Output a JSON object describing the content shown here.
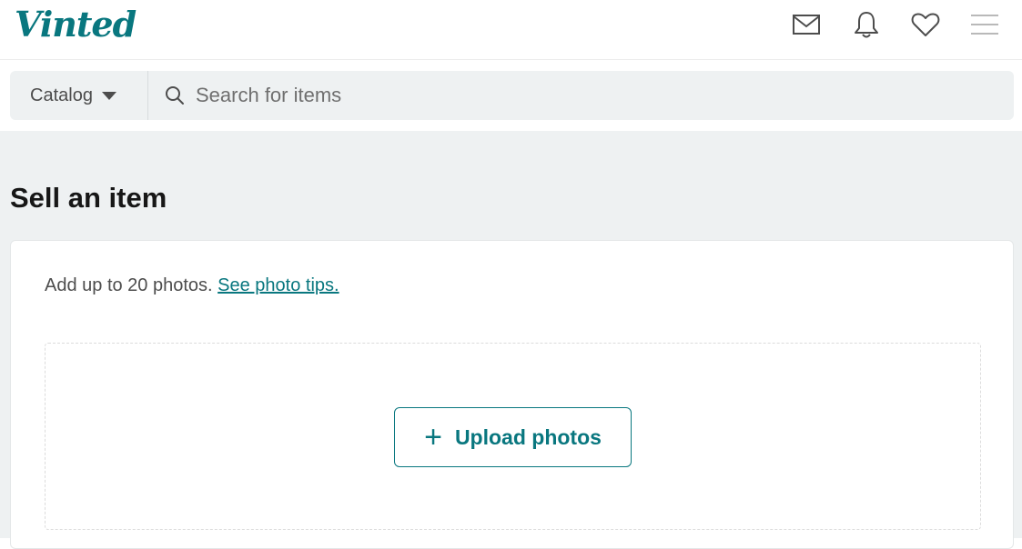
{
  "brand": {
    "logo_text": "Vinted",
    "accent_color": "#09777f"
  },
  "header": {
    "icons": [
      "mail-icon",
      "bell-icon",
      "heart-icon",
      "menu-icon"
    ]
  },
  "search": {
    "catalog_label": "Catalog",
    "placeholder": "Search for items"
  },
  "page": {
    "title": "Sell an item"
  },
  "upload": {
    "hint_text": "Add up to 20 photos.",
    "hint_link": "See photo tips.",
    "button_plus": "+",
    "button_label": "Upload photos"
  }
}
